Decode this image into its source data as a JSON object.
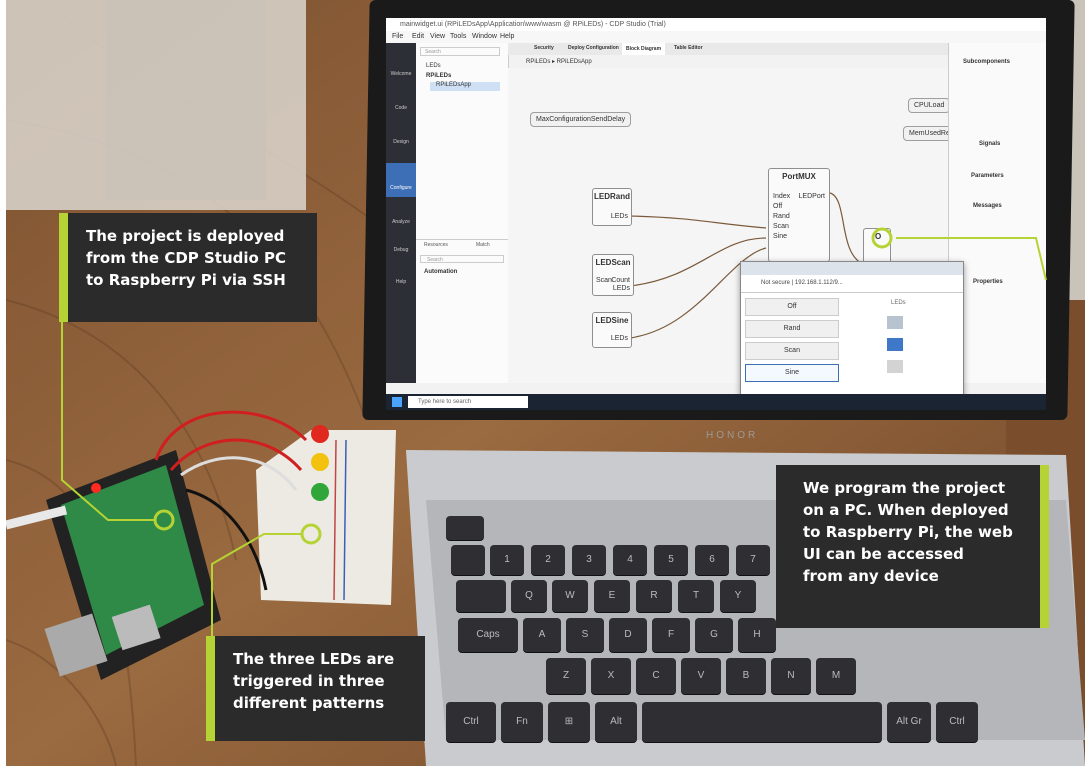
{
  "callouts": {
    "deploy": "The project is deployed\nfrom the CDP Studio PC\nto Raspberry Pi via SSH",
    "program": "We program the project\non a PC. When deployed\nto Raspberry Pi, the web\nUI can be accessed\nfrom any device",
    "leds": "The three LEDs are\ntriggered in three\ndifferent patterns"
  },
  "laptop": {
    "brand": "HONOR",
    "window_title": "mainwidget.ui (RPiLEDsApp\\Application\\www\\wasm @ RPiLEDs) - CDP Studio (Trial)",
    "menu": [
      "File",
      "Edit",
      "View",
      "Tools",
      "Window",
      "Help"
    ],
    "tabs": [
      "Security",
      "Deploy Configuration",
      "Block Diagram",
      "Table Editor"
    ],
    "search_placeholder": "Search",
    "breadcrumb": "RPiLEDs  ▸  RPiLEDsApp",
    "tree": [
      "LEDs",
      "RPiLEDs",
      "RPiLEDsApp"
    ],
    "mode_buttons": [
      "Welcome",
      "Code",
      "Design",
      "Configure",
      "Analyze",
      "Debug",
      "Help"
    ],
    "left_panel_tabs": [
      "Resources",
      "Match"
    ],
    "left_panel_item": "Automation",
    "blocks": {
      "max_config": "MaxConfigurationSendDelay",
      "cpu_load": "CPULoad",
      "mem_used": "MemUsedRelative",
      "portmux": "PortMUX",
      "portmux_ports": [
        "Index",
        "Off",
        "Rand",
        "Scan",
        "Sine"
      ],
      "portmux_out": "LEDPort",
      "led_rand": "LEDRand",
      "led_scan": "LEDScan",
      "led_sine": "LEDSine",
      "leds_port": "LEDs",
      "scan_port": "Scan",
      "count_port": "Count",
      "io": "IO"
    },
    "right_panel": {
      "subcomponents": "Subcomponents",
      "signals": "Signals",
      "parameters": "Parameters",
      "messages": "Messages",
      "properties": "Properties"
    }
  },
  "web_ui": {
    "address": "Not secure  |  192.168.1.112/9...",
    "buttons": [
      "Off",
      "Rand",
      "Scan",
      "Sine"
    ],
    "leds_header": "LEDs",
    "led_colors": [
      "#b7c4cf",
      "#3f78c9",
      "#d3d3d3"
    ]
  },
  "taskbar": {
    "search": "Type here to search"
  },
  "keyboard": {
    "row1": [
      "Q",
      "W",
      "E",
      "R",
      "T",
      "Y"
    ],
    "row2": [
      "Caps",
      "A",
      "S",
      "D",
      "F",
      "G",
      "H"
    ],
    "row3": [
      "Z",
      "X",
      "C",
      "V",
      "B",
      "N",
      "M"
    ],
    "row4": [
      "Ctrl",
      "Fn",
      "⊞",
      "Alt",
      "Alt Gr",
      "Ctrl"
    ],
    "numbers": [
      "1",
      "2",
      "3",
      "4",
      "5",
      "6",
      "7"
    ]
  },
  "colors": {
    "accent": "#b5d334",
    "callout_bg": "#2b2b2b",
    "table_wood": "#8a5a33",
    "led_red": "#e0281e",
    "led_yellow": "#f2c20f",
    "led_green": "#2fa53a",
    "pi_board": "#2e8a46"
  }
}
